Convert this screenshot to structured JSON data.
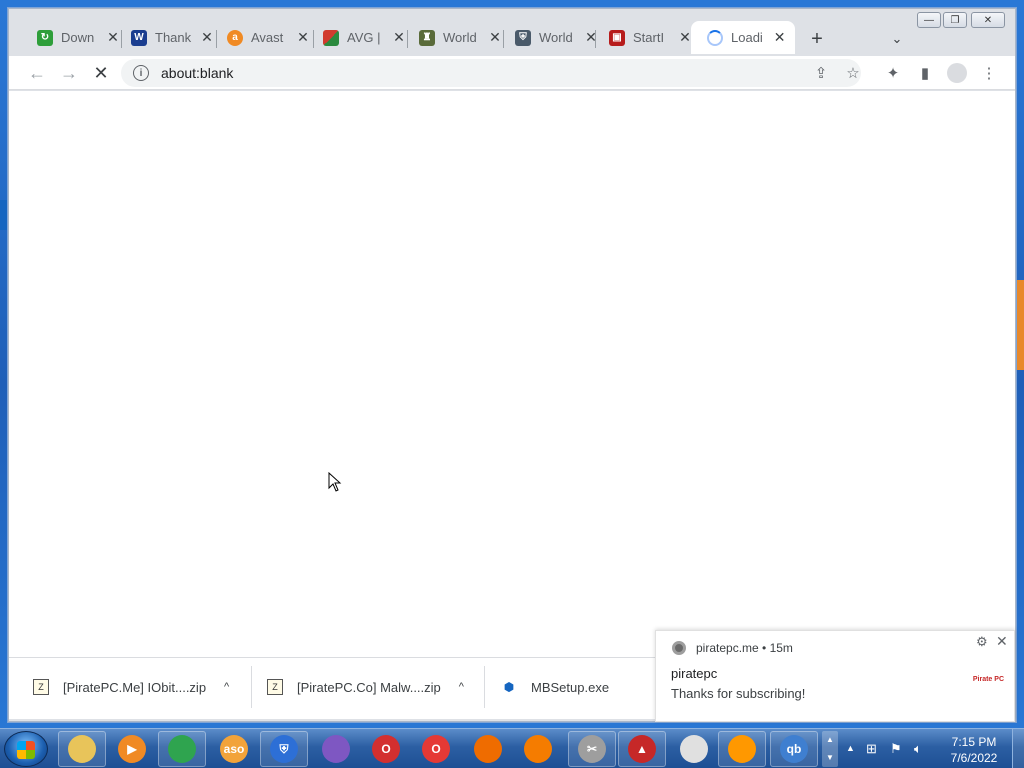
{
  "browser": {
    "tabs": [
      {
        "title": "Down",
        "icon": "download-site-icon",
        "color": "#2e9e3a"
      },
      {
        "title": "Thank",
        "icon": "w-logo-icon",
        "color": "#1a3d8f"
      },
      {
        "title": "Avast",
        "icon": "avast-icon",
        "color": "#f08a24"
      },
      {
        "title": "AVG |",
        "icon": "avg-icon",
        "color": "#d13b2e"
      },
      {
        "title": "World",
        "icon": "world-site-icon",
        "color": "#5a6b3a"
      },
      {
        "title": "World",
        "icon": "shield-site-icon",
        "color": "#4a5a6a"
      },
      {
        "title": "StartI",
        "icon": "startisback-icon",
        "color": "#b71c1c"
      },
      {
        "title": "Loadi",
        "icon": "loading-spinner-icon",
        "color": "#1a73e8"
      }
    ],
    "new_tab": "+",
    "tab_search": "⌄",
    "url": "about:blank",
    "info_glyph": "i"
  },
  "downloads": [
    {
      "name": "[PiratePC.Me] IObit....zip",
      "caret": "^"
    },
    {
      "name": "[PiratePC.Co] Malw....zip",
      "caret": "^"
    },
    {
      "name": "MBSetup.exe",
      "caret": ""
    }
  ],
  "notification": {
    "source": "piratepc.me  •  15m",
    "title": "piratepc",
    "body": "Thanks for subscribing!",
    "logo_text": "Pirate PC"
  },
  "taskbar": {
    "apps": [
      {
        "name": "explorer-icon",
        "label": "",
        "color": "#e8c45a"
      },
      {
        "name": "media-player-icon",
        "label": "▶",
        "color": "#f08a24"
      },
      {
        "name": "chrome-icon",
        "label": "",
        "color": "#2fa44f"
      },
      {
        "name": "aso-icon",
        "label": "aso",
        "color": "#f2a33a"
      },
      {
        "name": "defender-shield-icon",
        "label": "⛨",
        "color": "#2d6fd6"
      },
      {
        "name": "avast-secure-browser-icon",
        "label": "",
        "color": "#7e57c2"
      },
      {
        "name": "opera-icon",
        "label": "O",
        "color": "#d32f2f"
      },
      {
        "name": "opera-gx-icon",
        "label": "O",
        "color": "#e53935"
      },
      {
        "name": "office-icon",
        "label": "",
        "color": "#ef6c00"
      },
      {
        "name": "avast-browser-icon",
        "label": "",
        "color": "#f57c00"
      },
      {
        "name": "tools-icon",
        "label": "✂",
        "color": "#9e9e9e"
      },
      {
        "name": "startisback-icon",
        "label": "▲",
        "color": "#c62828"
      },
      {
        "name": "detective-hat-icon",
        "label": "",
        "color": "#e0e0e0"
      },
      {
        "name": "avg-icon",
        "label": "",
        "color": "#ff9800"
      },
      {
        "name": "qbittorrent-icon",
        "label": "qb",
        "color": "#3f7fd0"
      }
    ],
    "clock_time": "7:15 PM",
    "clock_date": "7/6/2022"
  }
}
